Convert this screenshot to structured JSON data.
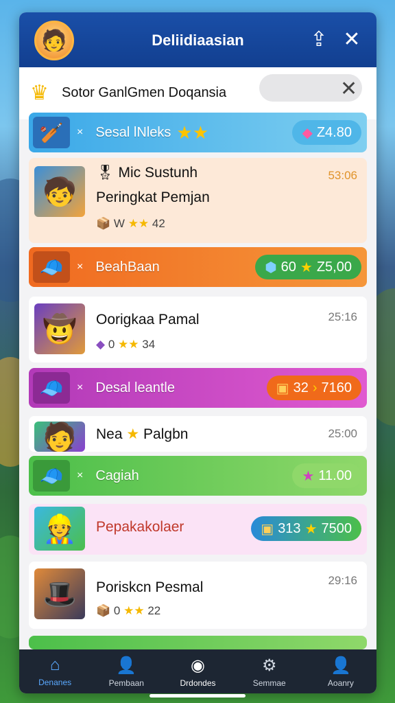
{
  "header": {
    "title": "Deliidiaasian"
  },
  "search": {
    "label": "Sotor GanlGmen Doqansia"
  },
  "rows": [
    {
      "kind": "band",
      "name": "Sesal lNleks",
      "value": "Z4.80"
    },
    {
      "kind": "card",
      "title": "Mic Sustunh",
      "subtitle": "Peringkat Pemjan",
      "stats": "W",
      "score": "42",
      "time": "53:06"
    },
    {
      "kind": "band",
      "name": "BeahBaan",
      "value1": "60",
      "value2": "Z5,00"
    },
    {
      "kind": "card",
      "title": "Oorigkaa Pamal",
      "stats": "0",
      "score": "34",
      "time": "25:16"
    },
    {
      "kind": "band",
      "name": "Desal leantle",
      "value1": "32",
      "value2": "7160"
    },
    {
      "kind": "card",
      "title": "Nea",
      "title2": "Palgbn",
      "time": "25:00"
    },
    {
      "kind": "band",
      "name": "Cagiah",
      "value": "11.00"
    },
    {
      "kind": "card",
      "title": "Pepakakolaer",
      "value1": "313",
      "value2": "7500"
    },
    {
      "kind": "card",
      "title": "Poriskcn Pesmal",
      "stats": "0",
      "score": "22",
      "time": "29:16"
    }
  ],
  "nav": [
    {
      "label": "Denanes",
      "icon": "home-icon"
    },
    {
      "label": "Pembaan",
      "icon": "user-icon"
    },
    {
      "label": "Drdondes",
      "icon": "compass-icon"
    },
    {
      "label": "Semmae",
      "icon": "gear-icon"
    },
    {
      "label": "Aoanry",
      "icon": "profile-icon"
    }
  ],
  "colors": {
    "header": "#1a4fa8",
    "nav_active": "#5aa9ff"
  }
}
